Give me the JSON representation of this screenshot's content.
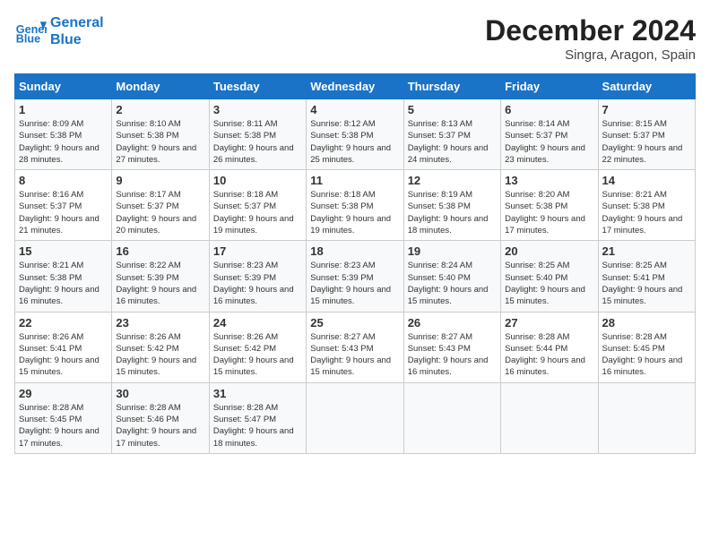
{
  "logo": {
    "line1": "General",
    "line2": "Blue"
  },
  "title": "December 2024",
  "subtitle": "Singra, Aragon, Spain",
  "days_of_week": [
    "Sunday",
    "Monday",
    "Tuesday",
    "Wednesday",
    "Thursday",
    "Friday",
    "Saturday"
  ],
  "weeks": [
    [
      {
        "day": "1",
        "sunrise": "8:09 AM",
        "sunset": "5:38 PM",
        "daylight": "9 hours and 28 minutes."
      },
      {
        "day": "2",
        "sunrise": "8:10 AM",
        "sunset": "5:38 PM",
        "daylight": "9 hours and 27 minutes."
      },
      {
        "day": "3",
        "sunrise": "8:11 AM",
        "sunset": "5:38 PM",
        "daylight": "9 hours and 26 minutes."
      },
      {
        "day": "4",
        "sunrise": "8:12 AM",
        "sunset": "5:38 PM",
        "daylight": "9 hours and 25 minutes."
      },
      {
        "day": "5",
        "sunrise": "8:13 AM",
        "sunset": "5:37 PM",
        "daylight": "9 hours and 24 minutes."
      },
      {
        "day": "6",
        "sunrise": "8:14 AM",
        "sunset": "5:37 PM",
        "daylight": "9 hours and 23 minutes."
      },
      {
        "day": "7",
        "sunrise": "8:15 AM",
        "sunset": "5:37 PM",
        "daylight": "9 hours and 22 minutes."
      }
    ],
    [
      {
        "day": "8",
        "sunrise": "8:16 AM",
        "sunset": "5:37 PM",
        "daylight": "9 hours and 21 minutes."
      },
      {
        "day": "9",
        "sunrise": "8:17 AM",
        "sunset": "5:37 PM",
        "daylight": "9 hours and 20 minutes."
      },
      {
        "day": "10",
        "sunrise": "8:18 AM",
        "sunset": "5:37 PM",
        "daylight": "9 hours and 19 minutes."
      },
      {
        "day": "11",
        "sunrise": "8:18 AM",
        "sunset": "5:38 PM",
        "daylight": "9 hours and 19 minutes."
      },
      {
        "day": "12",
        "sunrise": "8:19 AM",
        "sunset": "5:38 PM",
        "daylight": "9 hours and 18 minutes."
      },
      {
        "day": "13",
        "sunrise": "8:20 AM",
        "sunset": "5:38 PM",
        "daylight": "9 hours and 17 minutes."
      },
      {
        "day": "14",
        "sunrise": "8:21 AM",
        "sunset": "5:38 PM",
        "daylight": "9 hours and 17 minutes."
      }
    ],
    [
      {
        "day": "15",
        "sunrise": "8:21 AM",
        "sunset": "5:38 PM",
        "daylight": "9 hours and 16 minutes."
      },
      {
        "day": "16",
        "sunrise": "8:22 AM",
        "sunset": "5:39 PM",
        "daylight": "9 hours and 16 minutes."
      },
      {
        "day": "17",
        "sunrise": "8:23 AM",
        "sunset": "5:39 PM",
        "daylight": "9 hours and 16 minutes."
      },
      {
        "day": "18",
        "sunrise": "8:23 AM",
        "sunset": "5:39 PM",
        "daylight": "9 hours and 15 minutes."
      },
      {
        "day": "19",
        "sunrise": "8:24 AM",
        "sunset": "5:40 PM",
        "daylight": "9 hours and 15 minutes."
      },
      {
        "day": "20",
        "sunrise": "8:25 AM",
        "sunset": "5:40 PM",
        "daylight": "9 hours and 15 minutes."
      },
      {
        "day": "21",
        "sunrise": "8:25 AM",
        "sunset": "5:41 PM",
        "daylight": "9 hours and 15 minutes."
      }
    ],
    [
      {
        "day": "22",
        "sunrise": "8:26 AM",
        "sunset": "5:41 PM",
        "daylight": "9 hours and 15 minutes."
      },
      {
        "day": "23",
        "sunrise": "8:26 AM",
        "sunset": "5:42 PM",
        "daylight": "9 hours and 15 minutes."
      },
      {
        "day": "24",
        "sunrise": "8:26 AM",
        "sunset": "5:42 PM",
        "daylight": "9 hours and 15 minutes."
      },
      {
        "day": "25",
        "sunrise": "8:27 AM",
        "sunset": "5:43 PM",
        "daylight": "9 hours and 15 minutes."
      },
      {
        "day": "26",
        "sunrise": "8:27 AM",
        "sunset": "5:43 PM",
        "daylight": "9 hours and 16 minutes."
      },
      {
        "day": "27",
        "sunrise": "8:28 AM",
        "sunset": "5:44 PM",
        "daylight": "9 hours and 16 minutes."
      },
      {
        "day": "28",
        "sunrise": "8:28 AM",
        "sunset": "5:45 PM",
        "daylight": "9 hours and 16 minutes."
      }
    ],
    [
      {
        "day": "29",
        "sunrise": "8:28 AM",
        "sunset": "5:45 PM",
        "daylight": "9 hours and 17 minutes."
      },
      {
        "day": "30",
        "sunrise": "8:28 AM",
        "sunset": "5:46 PM",
        "daylight": "9 hours and 17 minutes."
      },
      {
        "day": "31",
        "sunrise": "8:28 AM",
        "sunset": "5:47 PM",
        "daylight": "9 hours and 18 minutes."
      },
      null,
      null,
      null,
      null
    ]
  ]
}
